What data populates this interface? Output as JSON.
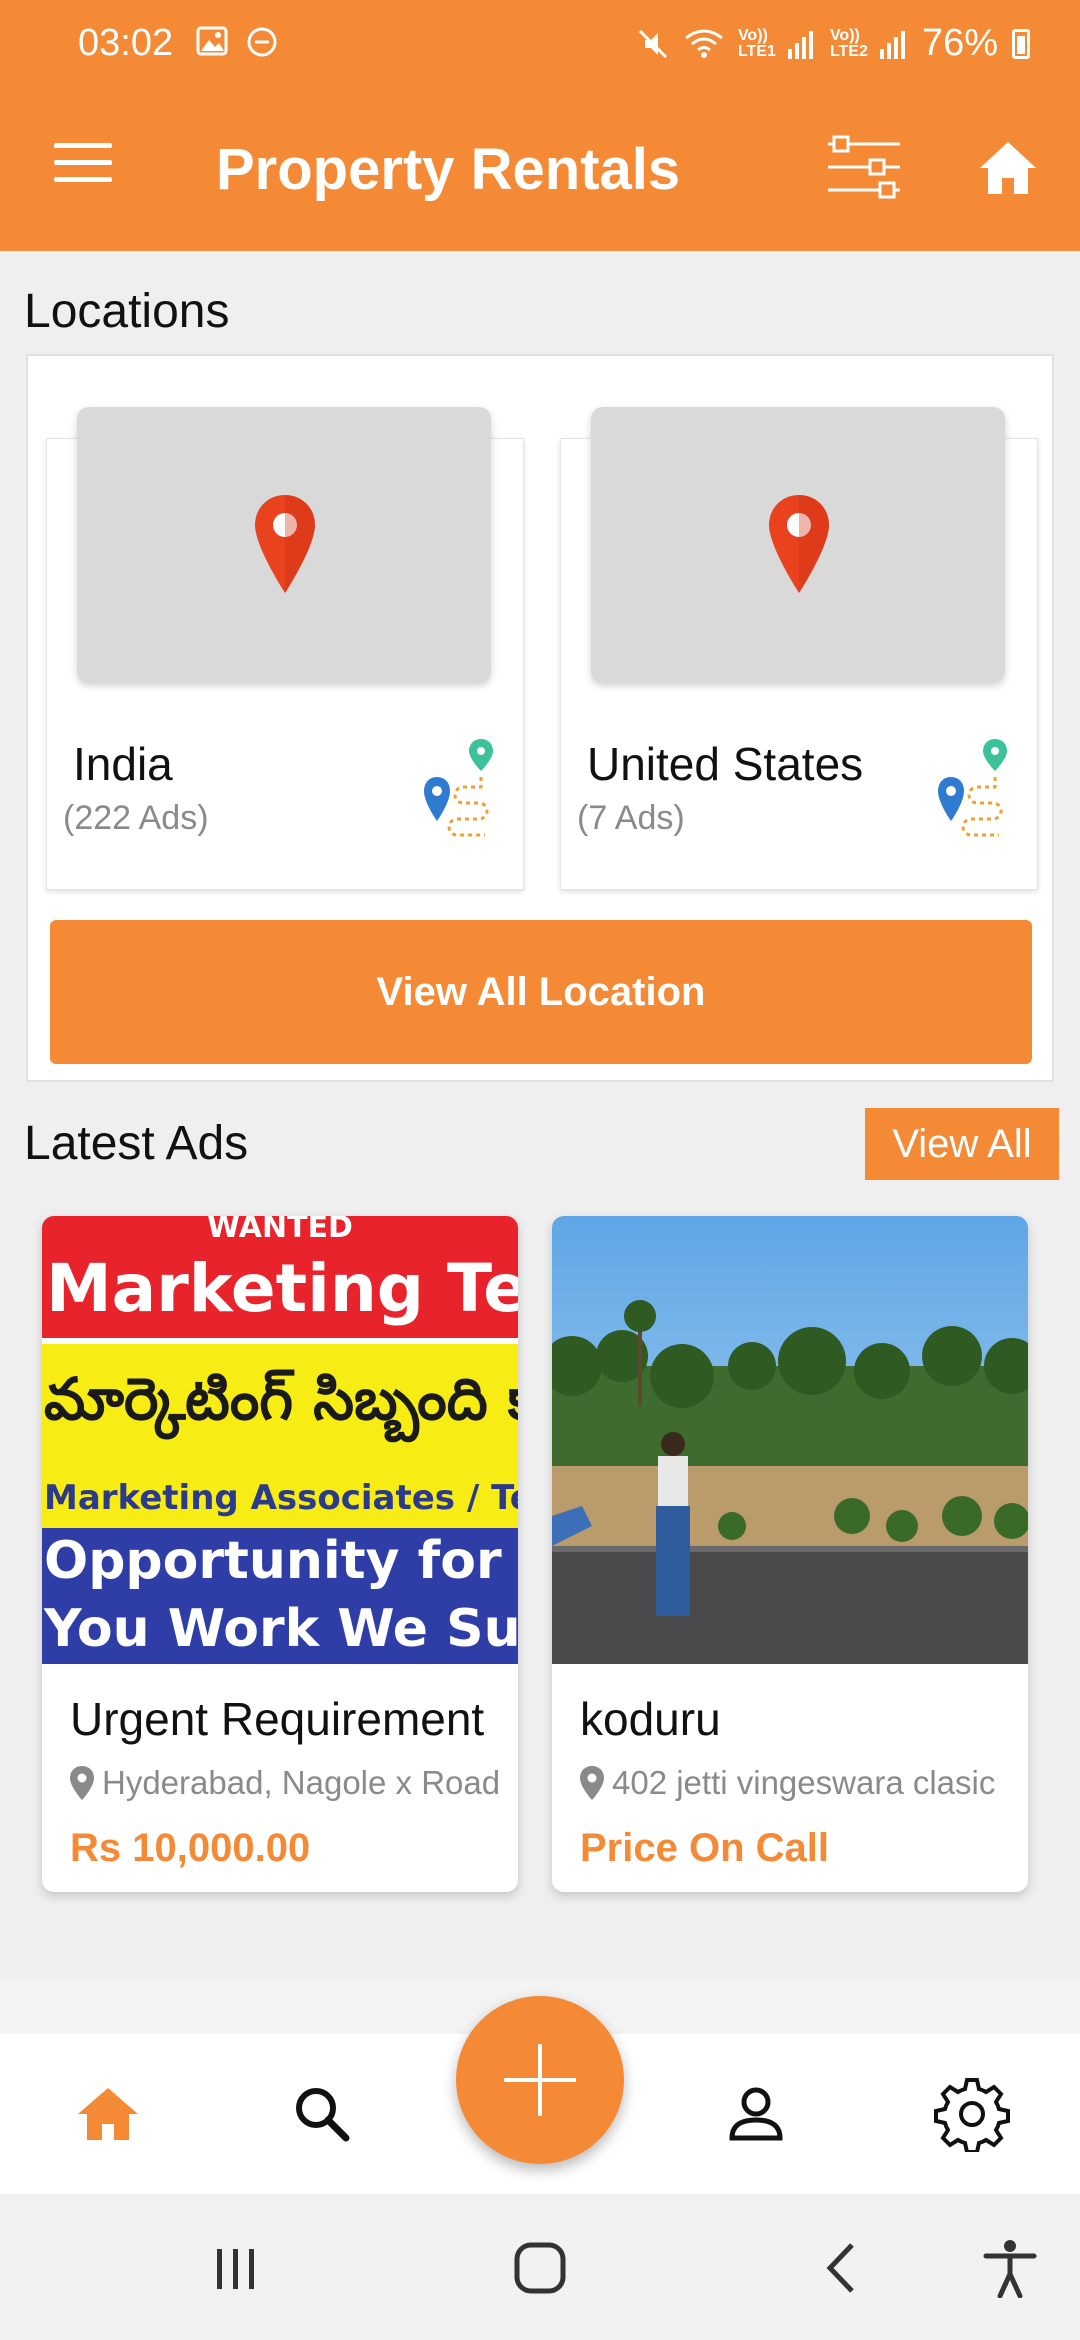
{
  "status_bar": {
    "time": "03:02",
    "network_1": "Vo)) LTE1",
    "network_2": "Vo)) LTE2",
    "battery": "76%",
    "icons": [
      "image-icon",
      "dnd-icon",
      "mute-icon",
      "wifi-icon",
      "signal-icon",
      "battery-icon"
    ]
  },
  "app_bar": {
    "title": "Property Rentals",
    "icons": [
      "menu-icon",
      "filter-icon",
      "home-icon"
    ]
  },
  "locations": {
    "heading": "Locations",
    "items": [
      {
        "name": "India",
        "count": "(222 Ads)"
      },
      {
        "name": "United States",
        "count": "(7 Ads)"
      }
    ],
    "view_all_label": "View All Location"
  },
  "latest_ads": {
    "heading": "Latest Ads",
    "view_all_label": "View All",
    "items": [
      {
        "title": "Urgent Requirement",
        "location": "Hyderabad, Nagole x Road",
        "price": "Rs 10,000.00",
        "banner_lines": [
          "WANTED",
          "Marketing Team",
          "మార్కెటింగ్ సిబ్బంది కావాలి",
          "Marketing Associates / Team Leaders / M",
          "Opportunity for Everyone",
          "You Work We Support"
        ]
      },
      {
        "title": "koduru",
        "location": "402 jetti vingeswara clasic",
        "price": "Price On Call"
      }
    ]
  },
  "bottom_nav": {
    "items": [
      "home-icon",
      "search-icon",
      "add-icon",
      "profile-icon",
      "settings-icon"
    ]
  },
  "colors": {
    "accent": "#f48a35",
    "pin_red": "#e8431e",
    "grey_text": "#8a8a8a"
  }
}
